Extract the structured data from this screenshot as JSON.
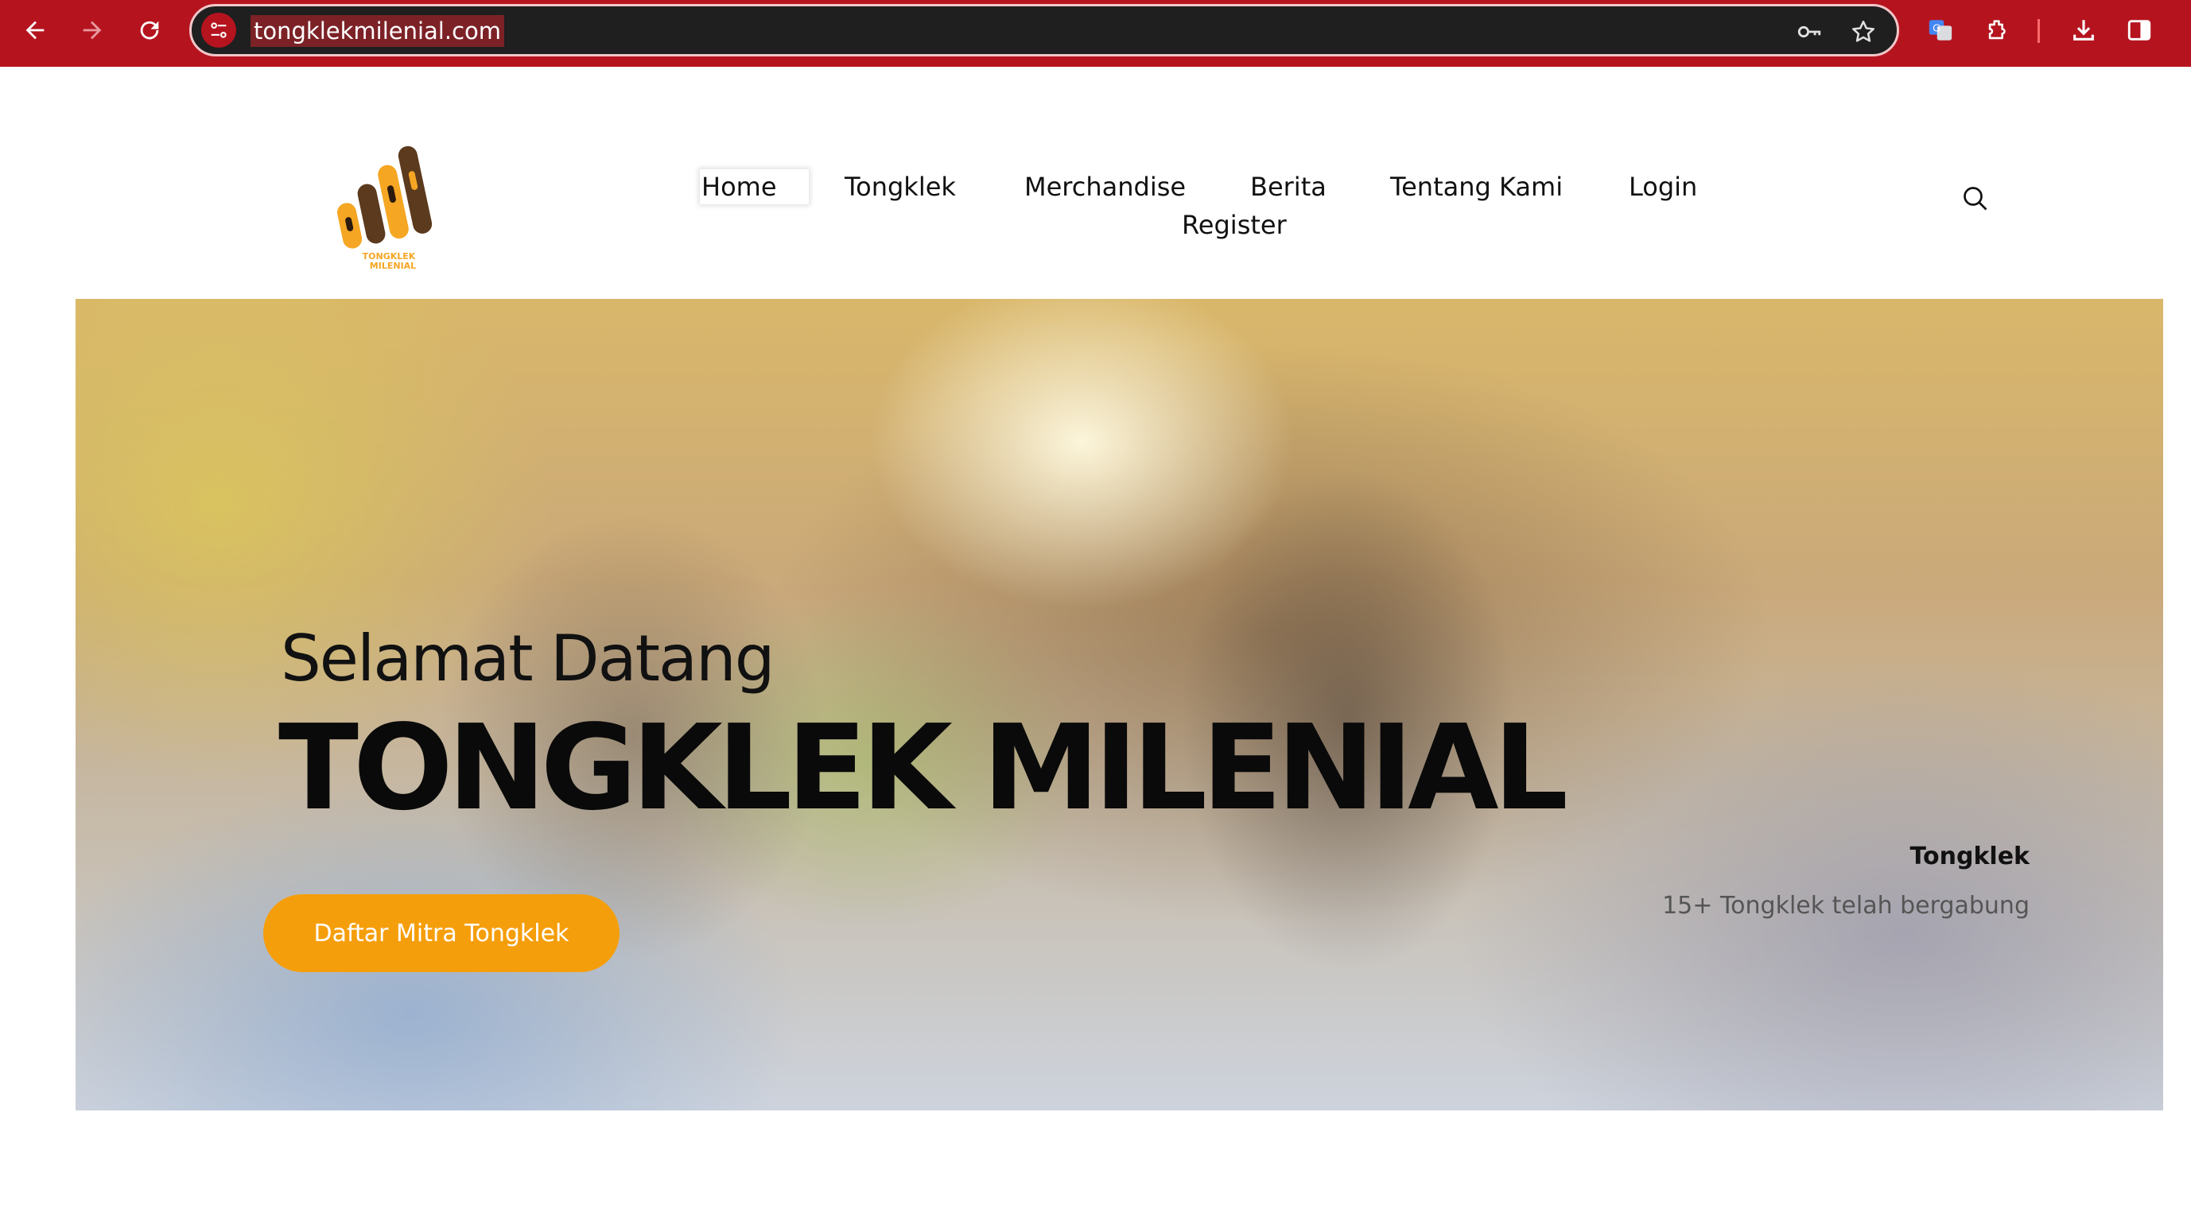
{
  "browser": {
    "url": "tongklekmilenial.com",
    "colors": {
      "frame": "#b5141f",
      "omnibox": "#1f1f1f"
    },
    "icons": [
      "back-icon",
      "forward-icon",
      "reload-icon",
      "site-info-icon",
      "key-icon",
      "star-icon",
      "translate-icon",
      "extensions-icon",
      "download-icon",
      "side-panel-icon"
    ]
  },
  "site": {
    "logo_text": "TONGKLEK MILENIAL",
    "nav": {
      "home": "Home",
      "tongklek": "Tongklek",
      "merchandise": "Merchandise",
      "berita": "Berita",
      "tentang_kami": "Tentang Kami",
      "login": "Login",
      "register": "Register"
    },
    "search_icon": "search-icon"
  },
  "hero": {
    "greeting": "Selamat Datang",
    "title": "TONGKLEK MILENIAL",
    "cta_label": "Daftar Mitra Tongklek",
    "stat_title": "Tongklek",
    "stat_desc": "15+ Tongklek telah bergabung",
    "colors": {
      "accent": "#f59e0b"
    }
  }
}
